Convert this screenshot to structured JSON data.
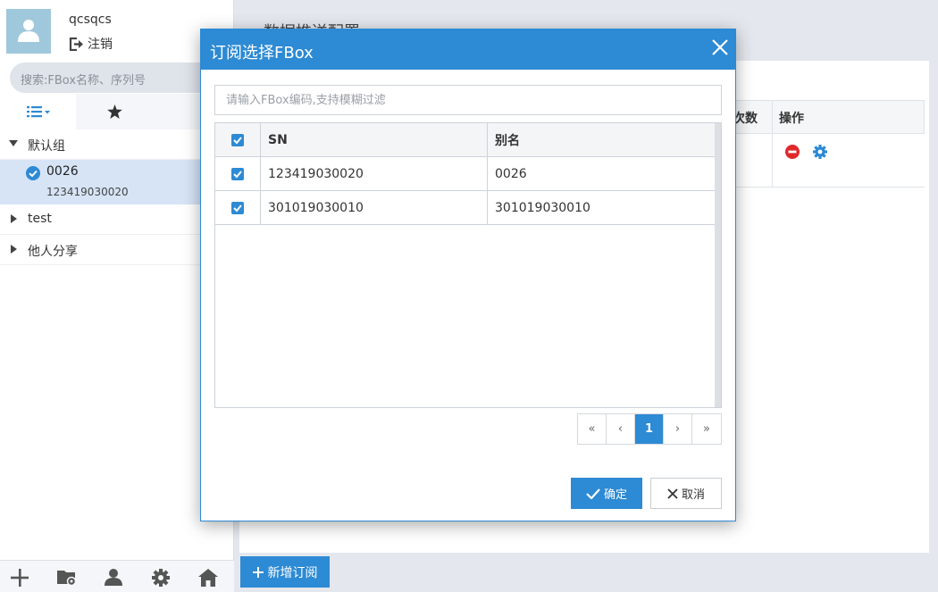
{
  "sidebar": {
    "username": "qcsqcs",
    "logout_label": "注销",
    "search_placeholder": "搜索:FBox名称、序列号",
    "groups": [
      {
        "label": "默认组",
        "devices": [
          {
            "name": "0026",
            "sn": "123419030020"
          }
        ]
      },
      {
        "label": "test"
      },
      {
        "label": "他人分享"
      }
    ],
    "bottom_icons": [
      "plus-icon",
      "folder-settings-icon",
      "user-icon",
      "gear-icon",
      "home-icon"
    ]
  },
  "main": {
    "title": "数据推送配置",
    "columns": {
      "times": "次数",
      "ops": "操作"
    },
    "add_button_label": "新增订阅"
  },
  "dialog": {
    "title": "订阅选择FBox",
    "filter_placeholder": "请输入FBox编码,支持模糊过滤",
    "columns": {
      "sn": "SN",
      "alias": "别名"
    },
    "rows": [
      {
        "sn": "123419030020",
        "alias": "0026",
        "checked": true
      },
      {
        "sn": "301019030010",
        "alias": "301019030010",
        "checked": true
      }
    ],
    "pager": {
      "first": "«",
      "prev": "‹",
      "current": "1",
      "next": "›",
      "last": "»"
    },
    "ok_label": "确定",
    "cancel_label": "取消"
  },
  "colors": {
    "accent": "#2d8ad4",
    "selected_row": "#d6e4f6",
    "danger": "#e0292b"
  }
}
